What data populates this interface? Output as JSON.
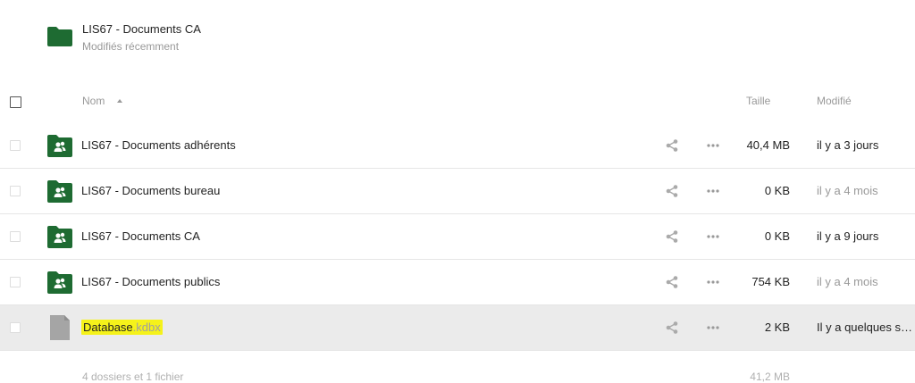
{
  "header": {
    "title": "LIS67 - Documents CA",
    "subtitle": "Modifiés récemment",
    "icon": "folder-icon",
    "accent": "#1e6b32"
  },
  "columns": {
    "name": "Nom",
    "size": "Taille",
    "modified": "Modifié"
  },
  "rows": [
    {
      "name": "LIS67 - Documents adhérents",
      "ext": "",
      "type": "shared-folder",
      "size": "40,4 MB",
      "modified": "il y a 3 jours"
    },
    {
      "name": "LIS67 - Documents bureau",
      "ext": "",
      "type": "shared-folder",
      "size": "0 KB",
      "modified": "il y a 4 mois"
    },
    {
      "name": "LIS67 - Documents CA",
      "ext": "",
      "type": "shared-folder",
      "size": "0 KB",
      "modified": "il y a 9 jours"
    },
    {
      "name": "LIS67 - Documents publics",
      "ext": "",
      "type": "shared-folder",
      "size": "754 KB",
      "modified": "il y a 4 mois"
    },
    {
      "name": "Database",
      "ext": ".kdbx",
      "type": "file",
      "size": "2 KB",
      "modified": "Il y a quelques secondes",
      "highlight": "#f5f21a"
    }
  ],
  "summary": {
    "text": "4 dossiers et 1 fichier",
    "total_size": "41,2 MB"
  }
}
